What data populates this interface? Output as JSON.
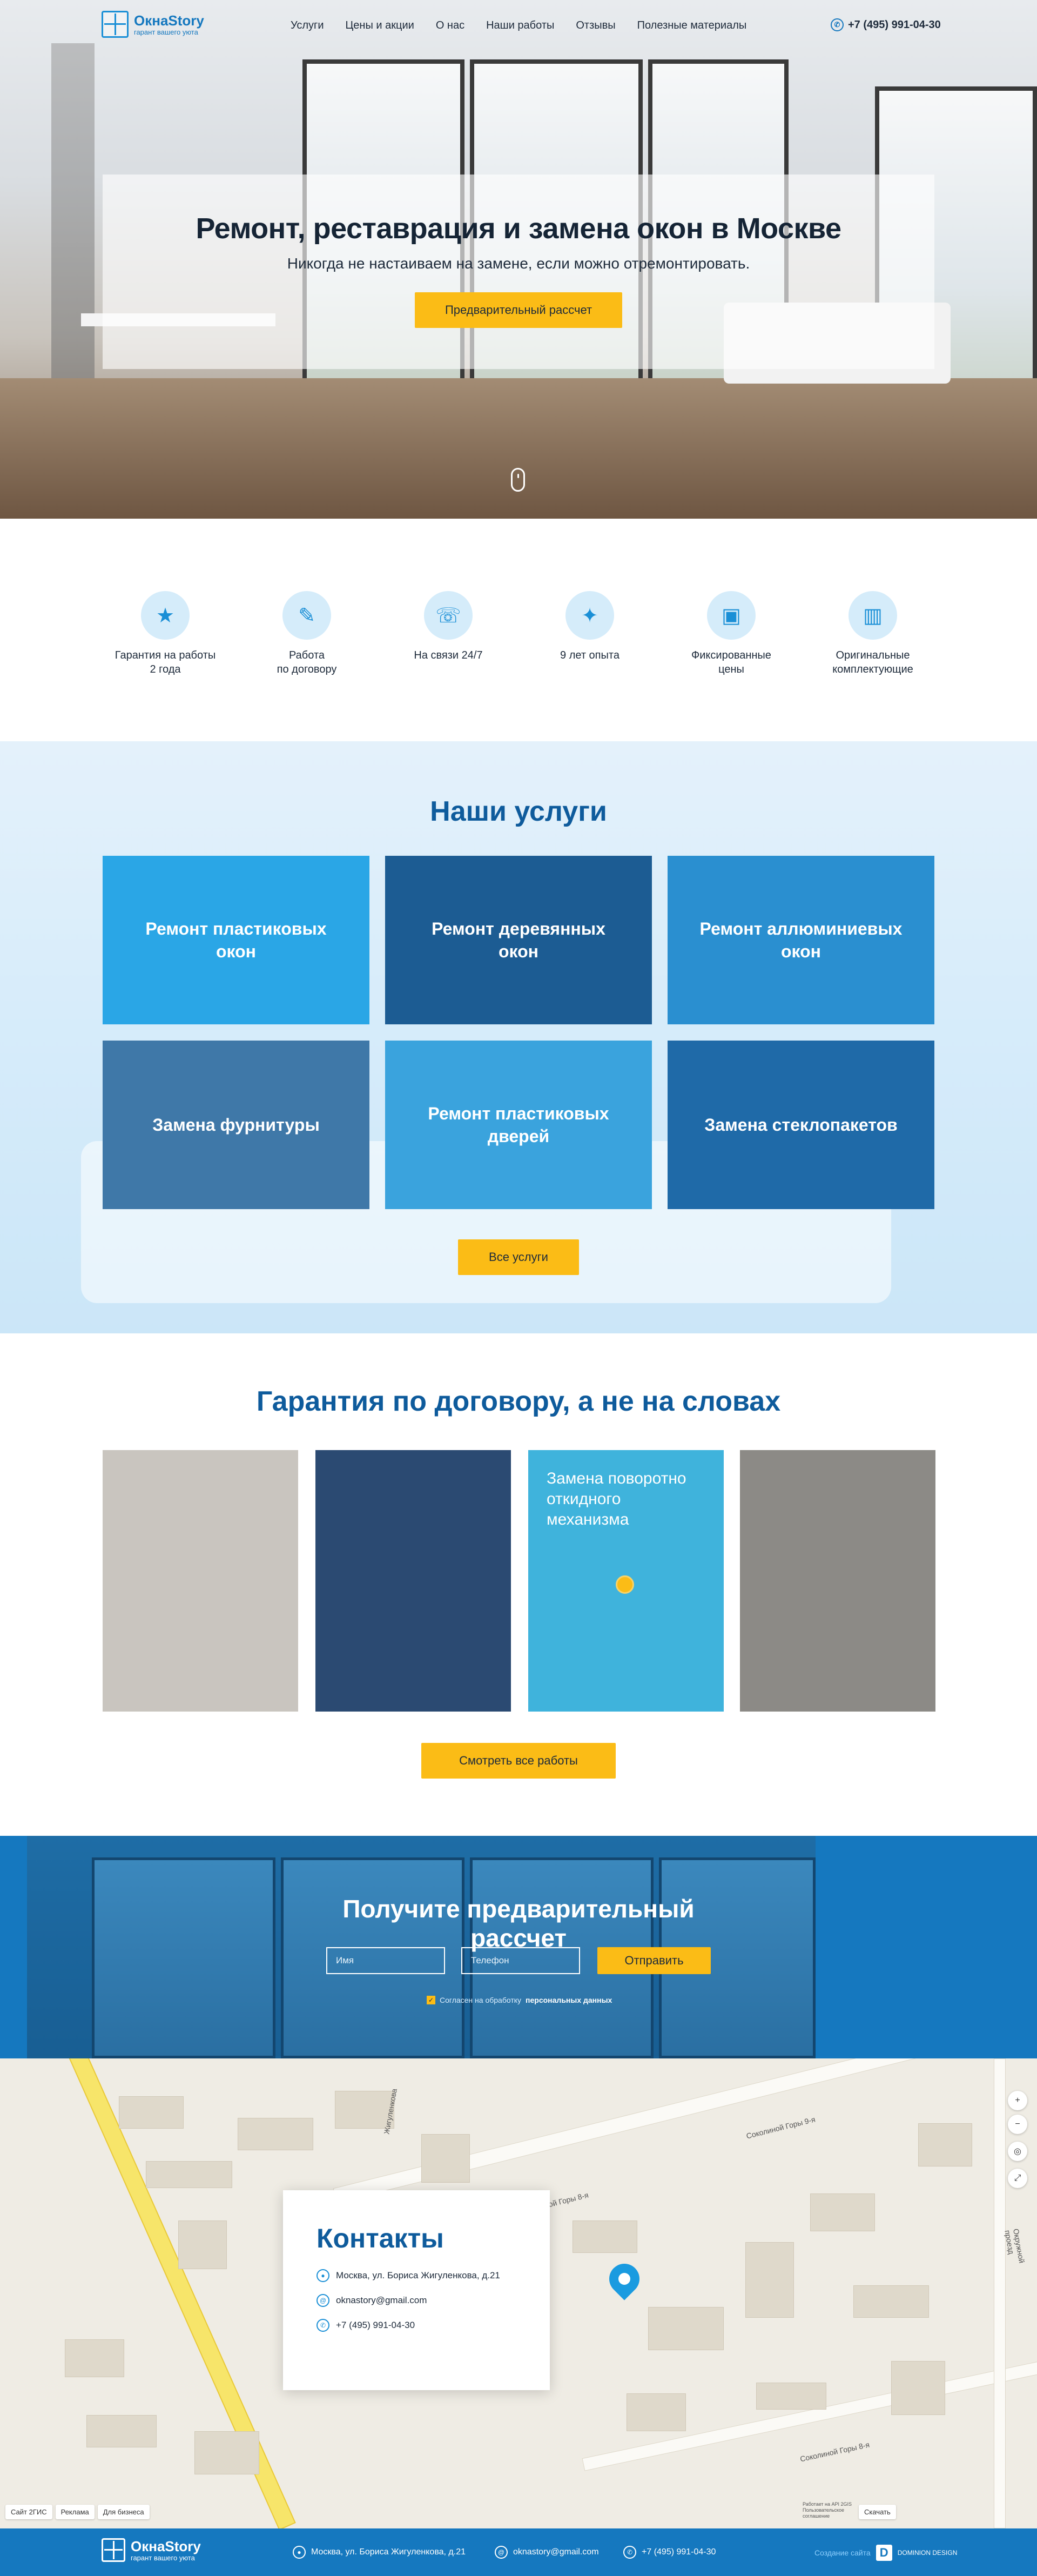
{
  "header": {
    "logo_name": "ОкнаStory",
    "logo_tagline": "гарант вашего уюта",
    "nav": [
      "Услуги",
      "Цены и акции",
      "О нас",
      "Наши работы",
      "Отзывы",
      "Полезные материалы"
    ],
    "phone": "+7 (495) 991-04-30"
  },
  "hero": {
    "title": "Ремонт, реставрация и замена окон в Москве",
    "subtitle": "Никогда не настаиваем на замене, если можно отремонтировать.",
    "button": "Предварительный рассчет"
  },
  "features": [
    {
      "icon": "shield-star-icon",
      "label": "Гарантия на работы\n2 года"
    },
    {
      "icon": "contract-icon",
      "label": "Работа\nпо договору"
    },
    {
      "icon": "phone-24-icon",
      "label": "На связи 24/7"
    },
    {
      "icon": "experience-icon",
      "label": "9 лет опыта"
    },
    {
      "icon": "wallet-icon",
      "label": "Фиксированные\nцены"
    },
    {
      "icon": "window-parts-icon",
      "label": "Оригинальные\nкомплектующие"
    }
  ],
  "services": {
    "title": "Наши услуги",
    "items": [
      {
        "label": "Ремонт пластиковых\nокон",
        "color": "#2aa6e6"
      },
      {
        "label": "Ремонт деревянных\nокон",
        "color": "#1c5c93"
      },
      {
        "label": "Ремонт аллюминиевых\nокон",
        "color": "#2a8fd0"
      },
      {
        "label": "Замена фурнитуры",
        "color": "#3f78a8"
      },
      {
        "label": "Ремонт пластиковых\nдверей",
        "color": "#3aa3dd"
      },
      {
        "label": "Замена стеклопакетов",
        "color": "#1f6aa8"
      }
    ],
    "button": "Все услуги"
  },
  "works": {
    "title": "Гарантия по договору, а не на словах",
    "items": [
      {
        "caption": "",
        "color": "#c9c5bf"
      },
      {
        "caption": "",
        "color": "#2b4a72"
      },
      {
        "caption": "Замена поворотно откидного механизма",
        "color": "#3fb3dc"
      },
      {
        "caption": "",
        "color": "#8c8a86"
      }
    ],
    "button": "Смотреть все работы"
  },
  "cta": {
    "title": "Получите предварительный рассчет",
    "name_placeholder": "Имя",
    "phone_placeholder": "Телефон",
    "button": "Отправить",
    "consent_text": "Согласен на обработку",
    "consent_link": "персональных данных"
  },
  "map": {
    "streets": [
      "Соколиной Горы 8-я",
      "Соколиной Горы 8-я",
      "Соколиной Горы 9-я",
      "Окружной проезд",
      "Жигуленкова"
    ],
    "bottom_chips": [
      "Сайт 2ГИС",
      "Реклама",
      "Для бизнеса"
    ],
    "tools_label": "Скачать",
    "copyright": "Работает на API 2GIS Пользовательское соглашение"
  },
  "contacts": {
    "title": "Контакты",
    "address": "Москва, ул. Бориса Жигуленкова, д.21",
    "email": "oknastory@gmail.com",
    "phone": "+7 (495) 991-04-30"
  },
  "footer": {
    "address": "Москва, ул. Бориса Жигуленкова, д.21",
    "email": "oknastory@gmail.com",
    "phone": "+7 (495) 991-04-30",
    "dev_label": "Создание сайта",
    "dev_name": "DOMINION DESIGN"
  }
}
